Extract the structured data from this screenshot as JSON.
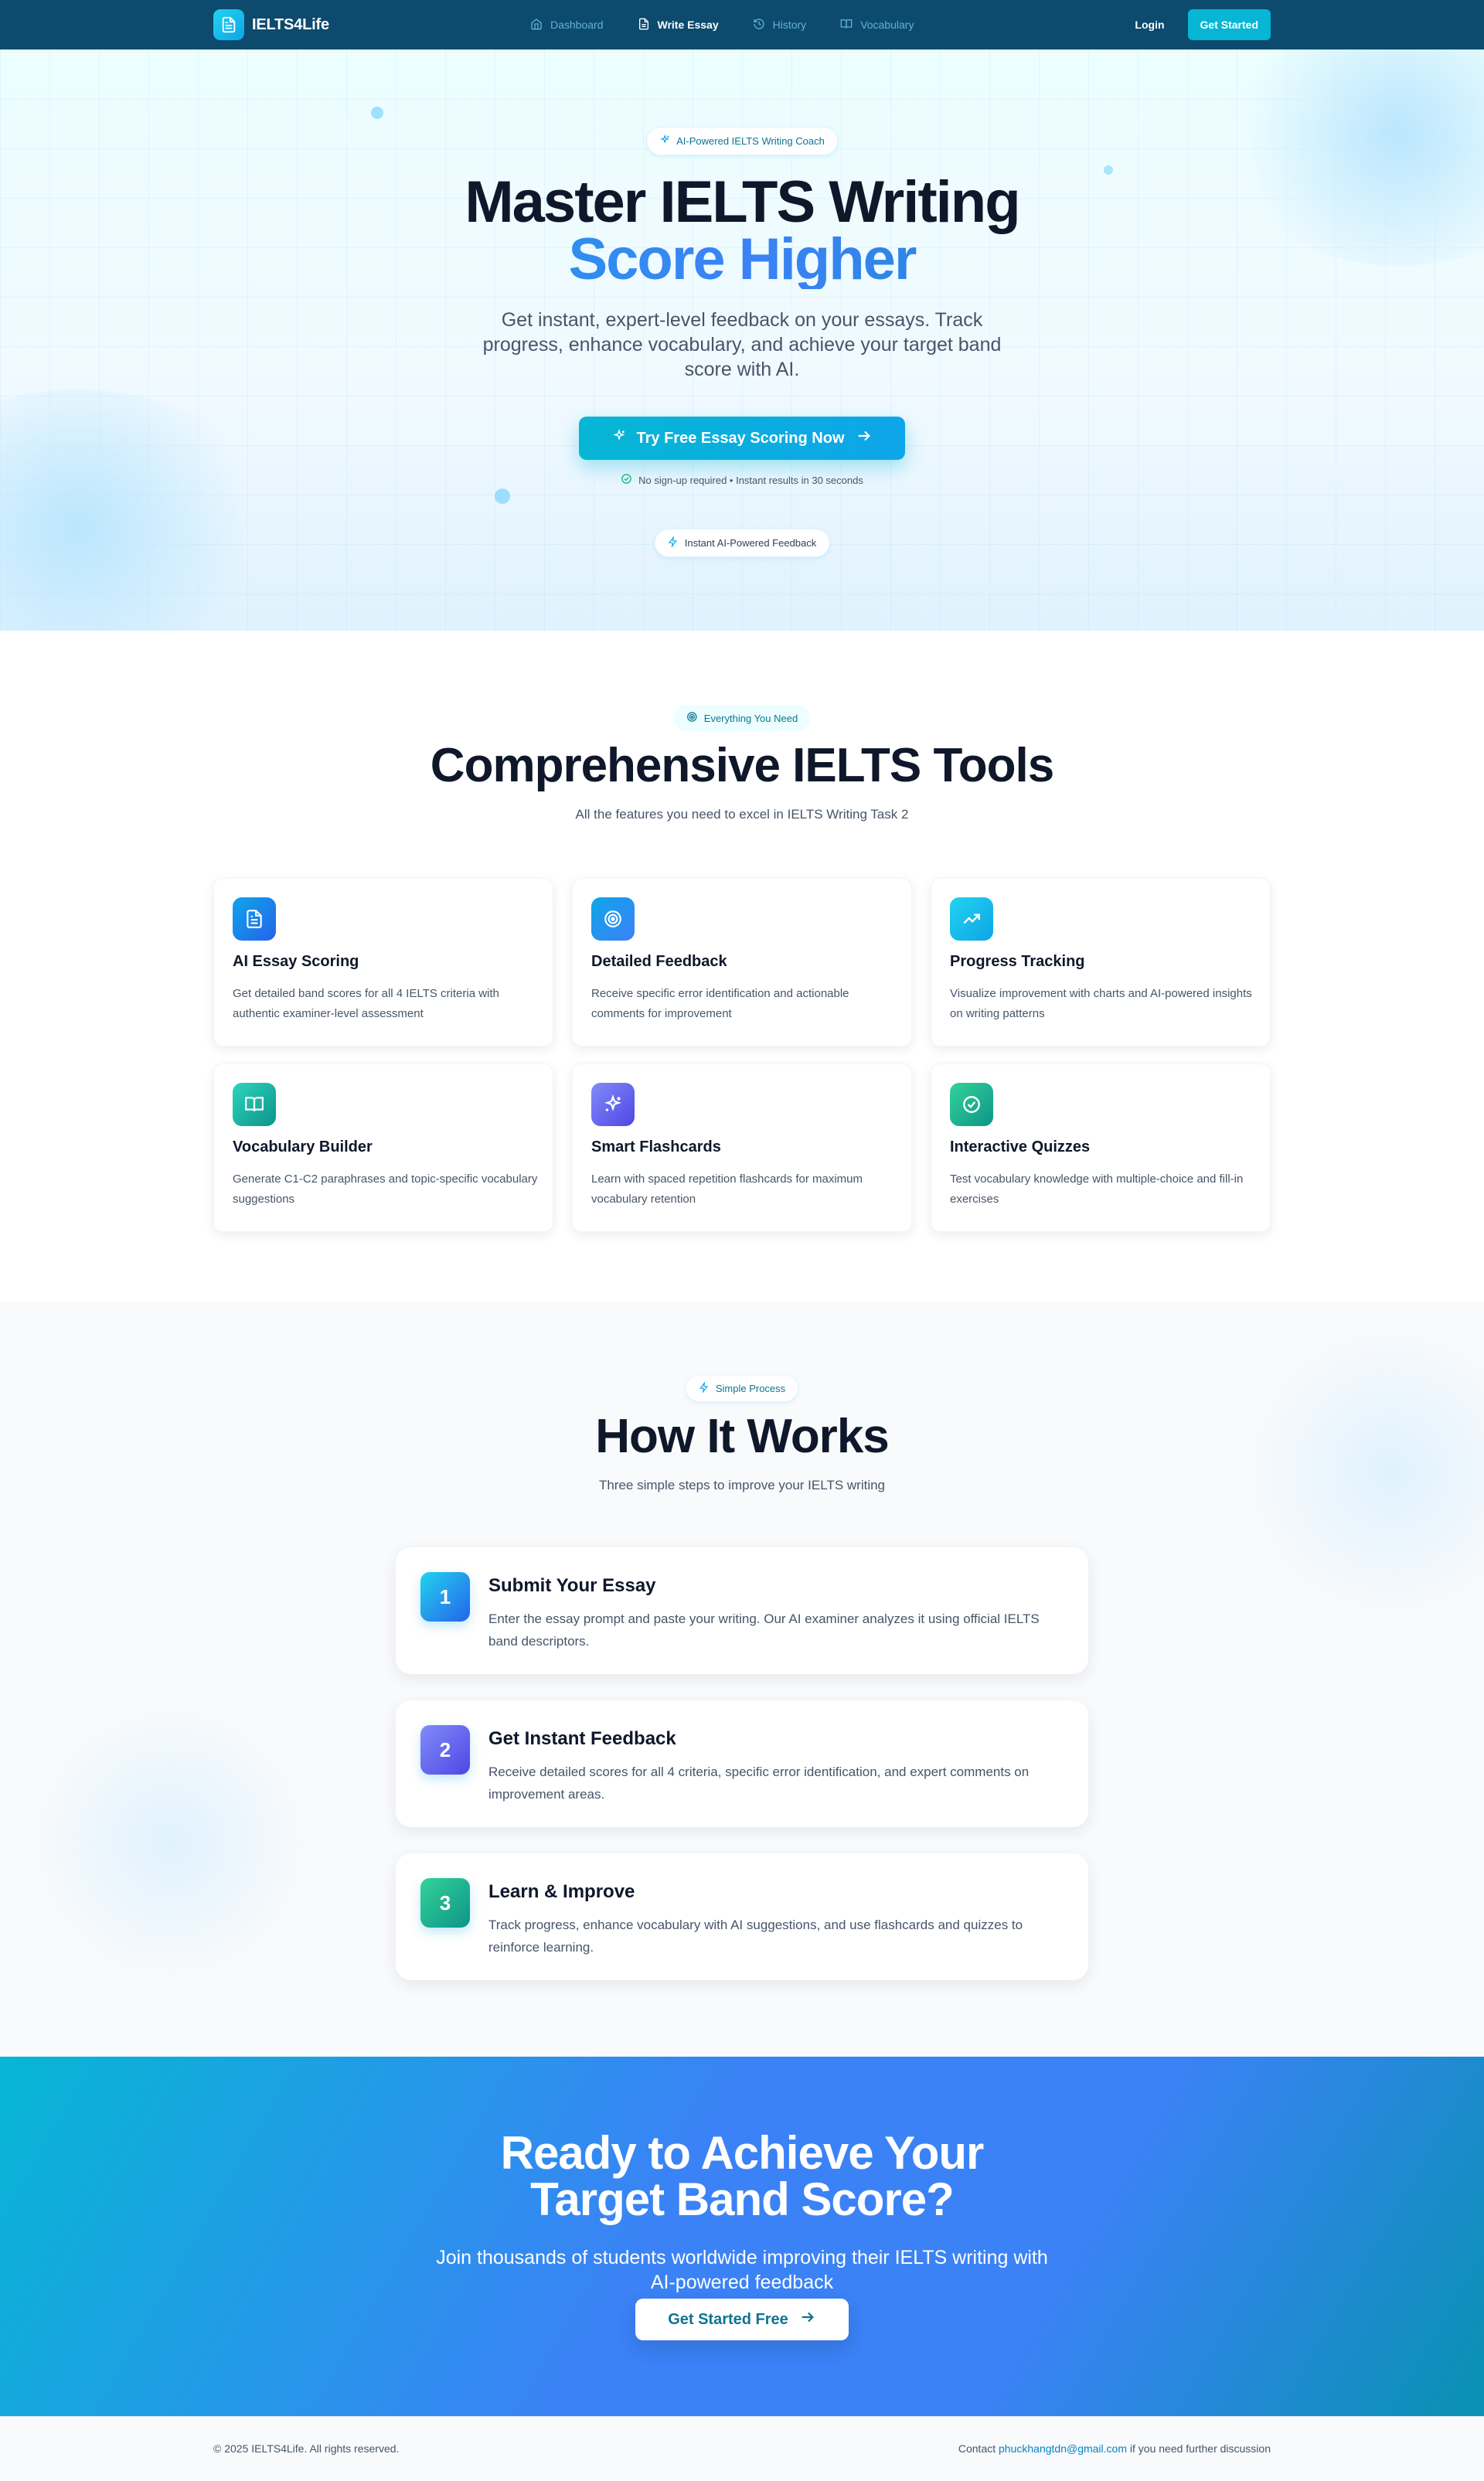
{
  "nav": {
    "brand": "IELTS4Life",
    "links": [
      {
        "label": "Dashboard",
        "icon": "home-icon",
        "active": false
      },
      {
        "label": "Write Essay",
        "icon": "document-icon",
        "active": true
      },
      {
        "label": "History",
        "icon": "history-icon",
        "active": false
      },
      {
        "label": "Vocabulary",
        "icon": "book-icon",
        "active": false
      }
    ],
    "login": "Login",
    "get_started": "Get Started"
  },
  "hero": {
    "badge": "AI-Powered IELTS Writing Coach",
    "title_line1": "Master IELTS Writing",
    "title_line2": "Score Higher",
    "subtitle": "Get instant, expert-level feedback on your essays. Track progress, enhance vocabulary, and achieve your target band score with AI.",
    "cta": "Try Free Essay Scoring Now",
    "note": "No sign-up required • Instant results in 30 seconds",
    "feature_badge": "Instant AI-Powered Feedback"
  },
  "features": {
    "badge": "Everything You Need",
    "title": "Comprehensive IELTS Tools",
    "subtitle": "All the features you need to excel in IELTS Writing Task 2",
    "cards": [
      {
        "title": "AI Essay Scoring",
        "desc": "Get detailed band scores for all 4 IELTS criteria with authentic examiner-level assessment",
        "icon": "document-icon",
        "color": "#0ea5e9"
      },
      {
        "title": "Detailed Feedback",
        "desc": "Receive specific error identification and actionable comments for improvement",
        "icon": "target-icon",
        "color": "#0ea5e9"
      },
      {
        "title": "Progress Tracking",
        "desc": "Visualize improvement with charts and AI-powered insights on writing patterns",
        "icon": "trending-up-icon",
        "color": "#06b6d4"
      },
      {
        "title": "Vocabulary Builder",
        "desc": "Generate C1-C2 paraphrases and topic-specific vocabulary suggestions",
        "icon": "book-open-icon",
        "color": "#14b8a6"
      },
      {
        "title": "Smart Flashcards",
        "desc": "Learn with spaced repetition flashcards for maximum vocabulary retention",
        "icon": "sparkles-icon",
        "color": "#6366f1"
      },
      {
        "title": "Interactive Quizzes",
        "desc": "Test vocabulary knowledge with multiple-choice and fill-in exercises",
        "icon": "check-circle-icon",
        "color": "#10b981"
      }
    ]
  },
  "how": {
    "badge": "Simple Process",
    "title": "How It Works",
    "subtitle": "Three simple steps to improve your IELTS writing",
    "steps": [
      {
        "num": "1",
        "title": "Submit Your Essay",
        "desc": "Enter the essay prompt and paste your writing. Our AI examiner analyzes it using official IELTS band descriptors."
      },
      {
        "num": "2",
        "title": "Get Instant Feedback",
        "desc": "Receive detailed scores for all 4 criteria, specific error identification, and expert comments on improvement areas."
      },
      {
        "num": "3",
        "title": "Learn & Improve",
        "desc": "Track progress, enhance vocabulary with AI suggestions, and use flashcards and quizzes to reinforce learning."
      }
    ]
  },
  "cta": {
    "title_line1": "Ready to Achieve Your",
    "title_line2": "Target Band Score?",
    "subtitle": "Join thousands of students worldwide improving their IELTS writing with AI-powered feedback",
    "button": "Get Started Free"
  },
  "footer": {
    "copyright": "© 2025 IELTS4Life. All rights reserved.",
    "contact_prefix": "Contact",
    "email": "phuckhangtdn@gmail.com",
    "contact_suffix": "if you need further discussion"
  }
}
